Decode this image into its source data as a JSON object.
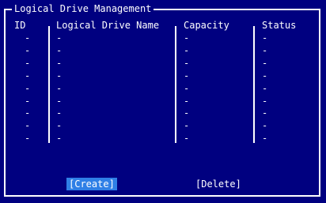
{
  "panel": {
    "title": "Logical Drive Management"
  },
  "table": {
    "columns": [
      "ID",
      "Logical Drive Name",
      "Capacity",
      "Status"
    ],
    "rows": [
      [
        "-",
        "-",
        "-",
        "-"
      ],
      [
        "-",
        "-",
        "-",
        "-"
      ],
      [
        "-",
        "-",
        "-",
        "-"
      ],
      [
        "-",
        "-",
        "-",
        "-"
      ],
      [
        "-",
        "-",
        "-",
        "-"
      ],
      [
        "-",
        "-",
        "-",
        "-"
      ],
      [
        "-",
        "-",
        "-",
        "-"
      ],
      [
        "-",
        "-",
        "-",
        "-"
      ],
      [
        "-",
        "-",
        "-",
        "-"
      ]
    ]
  },
  "actions": {
    "create_label": "[Create]",
    "delete_label": "[Delete]"
  },
  "colors": {
    "background": "#000080",
    "foreground": "#ffffff",
    "selected": "#2f7fe6"
  }
}
